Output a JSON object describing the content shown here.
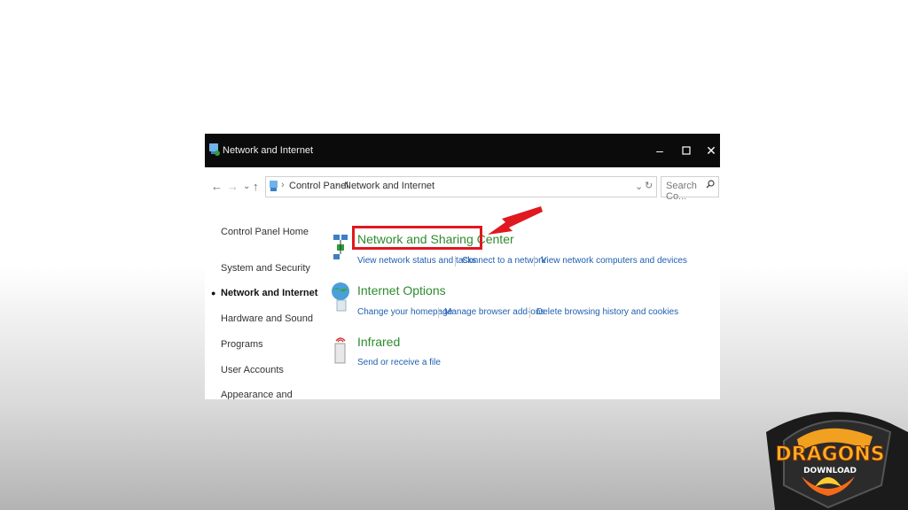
{
  "window": {
    "title": "Network and Internet",
    "minimize_icon": "minimize-icon",
    "maximize_icon": "maximize-icon",
    "close_icon": "close-icon"
  },
  "address": {
    "back": "←",
    "forward": "→",
    "recent": "⌄",
    "up": "↑",
    "crumbs": [
      "Control Panel",
      "Network and Internet"
    ],
    "dropdown": "⌄",
    "refresh": "↻",
    "search_placeholder": "Search Co...",
    "search_icon": "search-icon"
  },
  "sidebar": {
    "items": [
      {
        "label": "Control Panel Home"
      },
      {
        "label": "System and Security"
      },
      {
        "label": "Network and Internet",
        "active": true
      },
      {
        "label": "Hardware and Sound"
      },
      {
        "label": "Programs"
      },
      {
        "label": "User Accounts"
      },
      {
        "label": "Appearance and"
      }
    ]
  },
  "sections": [
    {
      "title": "Network and Sharing Center",
      "icon": "network-icon",
      "links": [
        "View network status and tasks",
        "Connect to a network",
        "View network computers and devices"
      ]
    },
    {
      "title": "Internet Options",
      "icon": "globe-icon",
      "links": [
        "Change your homepage",
        "Manage browser add-ons",
        "Delete browsing history and cookies"
      ]
    },
    {
      "title": "Infrared",
      "icon": "infrared-icon",
      "links": [
        "Send or receive a file"
      ]
    }
  ],
  "annotation": {
    "color": "#e0181f"
  },
  "watermark": {
    "brand": "DRAGONS",
    "sub": "DOWNLOAD"
  }
}
